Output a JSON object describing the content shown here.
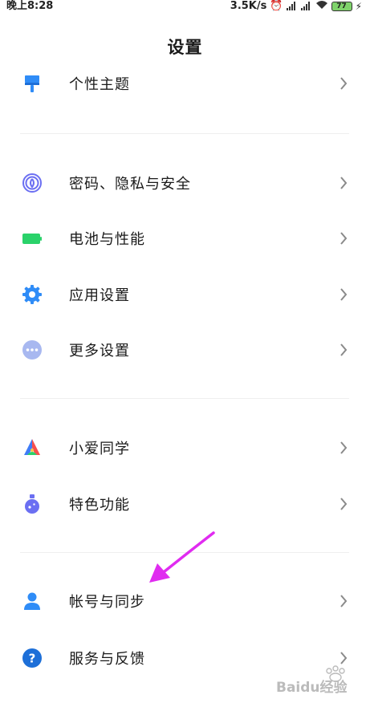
{
  "status_bar": {
    "time": "晚上8:28",
    "net_speed": "3.5K/s",
    "battery": "77"
  },
  "page": {
    "title": "设置"
  },
  "groups": [
    {
      "items": [
        {
          "label": "个性主题",
          "icon": "paintbrush-icon"
        }
      ]
    },
    {
      "items": [
        {
          "label": "密码、隐私与安全",
          "icon": "fingerprint-icon"
        },
        {
          "label": "电池与性能",
          "icon": "battery-icon"
        },
        {
          "label": "应用设置",
          "icon": "gear-icon"
        },
        {
          "label": "更多设置",
          "icon": "more-dots-icon"
        }
      ]
    },
    {
      "items": [
        {
          "label": "小爱同学",
          "icon": "xiaoai-icon"
        },
        {
          "label": "特色功能",
          "icon": "potion-icon"
        }
      ]
    },
    {
      "items": [
        {
          "label": "帐号与同步",
          "icon": "user-icon"
        },
        {
          "label": "服务与反馈",
          "icon": "help-icon"
        }
      ]
    }
  ],
  "watermark": {
    "text": "Baidu经验",
    "icon": "baidu-paw-icon"
  },
  "colors": {
    "accent_blue": "#2f8cf7",
    "battery_green": "#2ad26a",
    "pointer_magenta": "#e02bf0",
    "more_icon": "#a8b8f0"
  }
}
